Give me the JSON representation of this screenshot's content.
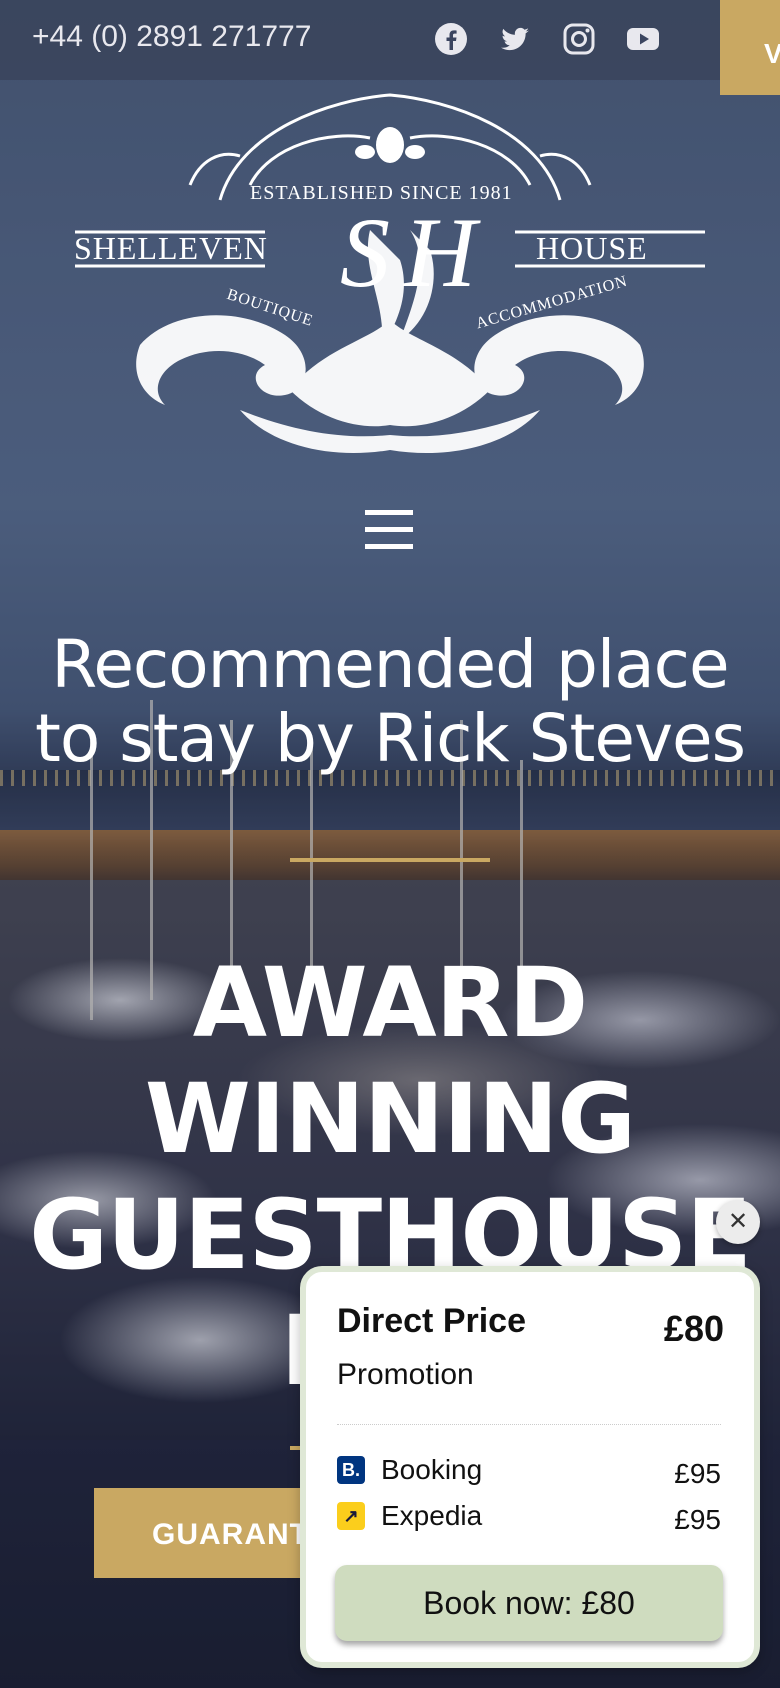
{
  "topbar": {
    "phone": "+44 (0) 2891 271777",
    "social_icons": [
      "facebook-icon",
      "twitter-icon",
      "instagram-icon",
      "youtube-icon"
    ],
    "side_tab_label": "V"
  },
  "logo": {
    "established": "ESTABLISHED SINCE 1981",
    "left_word": "SHELLEVEN",
    "right_word": "HOUSE",
    "monogram": "SH",
    "sub_left": "BOUTIQUE",
    "sub_right": "ACCOMMODATION"
  },
  "hero": {
    "tagline": "Recommended place to stay by Rick Steves",
    "headline": "AWARD WINNING GUESTHOUSE IN B",
    "cta_label": "GUARANT"
  },
  "price_widget": {
    "title": "Direct Price",
    "subtitle": "Promotion",
    "price": "£80",
    "close_icon": "close-icon",
    "competitors": [
      {
        "name": "Booking",
        "logo": "B.",
        "price": "£95",
        "color": "#003580"
      },
      {
        "name": "Expedia",
        "logo": "↗",
        "price": "£95",
        "color": "#fbce1c"
      }
    ],
    "book_label": "Book now: £80"
  },
  "colors": {
    "gold": "#c9a862",
    "popup_border": "#dfe8d6",
    "book_button": "#cfdcbf"
  }
}
